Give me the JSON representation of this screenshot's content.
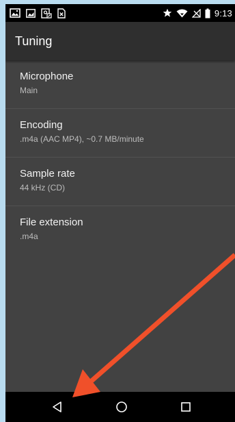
{
  "status_bar": {
    "left_icons": [
      "image-icon",
      "gallery-icon",
      "location-off-icon",
      "sim-card-icon"
    ],
    "right_icons": [
      "star-icon",
      "wifi-icon",
      "no-signal-icon",
      "battery-icon"
    ],
    "time": "9:13"
  },
  "app_bar": {
    "title": "Tuning"
  },
  "preferences": [
    {
      "title": "Microphone",
      "summary": "Main"
    },
    {
      "title": "Encoding",
      "summary": ".m4a (AAC MP4), ~0.7 MB/minute"
    },
    {
      "title": "Sample rate",
      "summary": "44 kHz (CD)"
    },
    {
      "title": "File extension",
      "summary": ".m4a"
    }
  ],
  "nav_bar": {
    "icons": [
      "back-icon",
      "home-icon",
      "recents-icon"
    ]
  },
  "annotation": {
    "icon": "arrow-annotation-icon",
    "color": "#f0502a"
  },
  "colors": {
    "background": "#424242",
    "app_bar": "#2f2f2f",
    "status_bar": "#000000",
    "nav_bar": "#000000",
    "page_border": "#b9dcf0"
  }
}
